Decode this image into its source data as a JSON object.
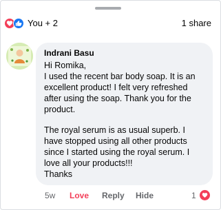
{
  "reactions": {
    "icons": [
      "love-icon",
      "like-icon"
    ],
    "count_label": "You + 2",
    "shares_label": "1 share"
  },
  "comment": {
    "avatar_icon": "profile-picture",
    "author": "Indrani Basu",
    "paragraphs": [
      [
        "Hi Romika,",
        "I used the recent bar body soap. It is an",
        "excellent product! I felt very refreshed",
        "after using the soap. Thank you for the",
        "product."
      ],
      [
        "The royal serum is as usual superb. I",
        "have stopped using all other products",
        "since I started using the royal serum. I",
        "love all your products!!!",
        "Thanks"
      ]
    ],
    "time": "5w",
    "actions": {
      "love": "Love",
      "reply": "Reply",
      "hide": "Hide"
    },
    "reaction_count": "1",
    "reaction_icon": "love-icon"
  },
  "colors": {
    "love_red": "#f33e58",
    "like_blue": "#1877f2",
    "bubble_bg": "#f0f2f5",
    "secondary_text": "#65676b"
  }
}
